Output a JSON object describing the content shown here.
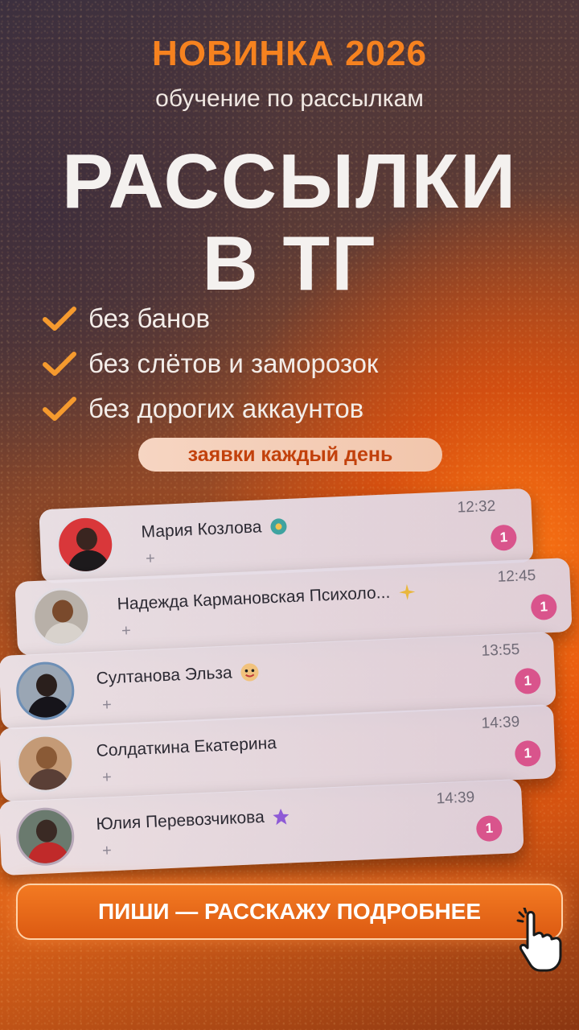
{
  "header": {
    "badge": "НОВИНКА 2026",
    "subtitle": "обучение по рассылкам"
  },
  "headline": {
    "line1": "РАССЫЛКИ",
    "line2": "В ТГ"
  },
  "features": [
    "без банов",
    "без слётов и заморозок",
    "без дорогих аккаунтов"
  ],
  "pill_label": "заявки каждый день",
  "chats": [
    {
      "name": "Мария Козлова",
      "time": "12:32",
      "unread": "1",
      "plus": "+",
      "badge_icon": "flower-emoji-icon"
    },
    {
      "name": "Надежда Кармановская Психоло...",
      "time": "12:45",
      "unread": "1",
      "plus": "+",
      "badge_icon": "sparkles-emoji-icon"
    },
    {
      "name": "Султанова Эльза",
      "time": "13:55",
      "unread": "1",
      "plus": "+",
      "badge_icon": "face-emoji-icon"
    },
    {
      "name": "Солдаткина Екатерина",
      "time": "14:39",
      "unread": "1",
      "plus": "+"
    },
    {
      "name": "Юлия Перевозчикова",
      "time": "14:39",
      "unread": "1",
      "plus": "+",
      "badge_icon": "star-emoji-icon"
    }
  ],
  "cta_label": "ПИШИ — РАССКАЖУ ПОДРОБНЕЕ",
  "colors": {
    "accent": "#f6821f",
    "badge": "#d9548c",
    "pill_text": "#c2410c"
  }
}
